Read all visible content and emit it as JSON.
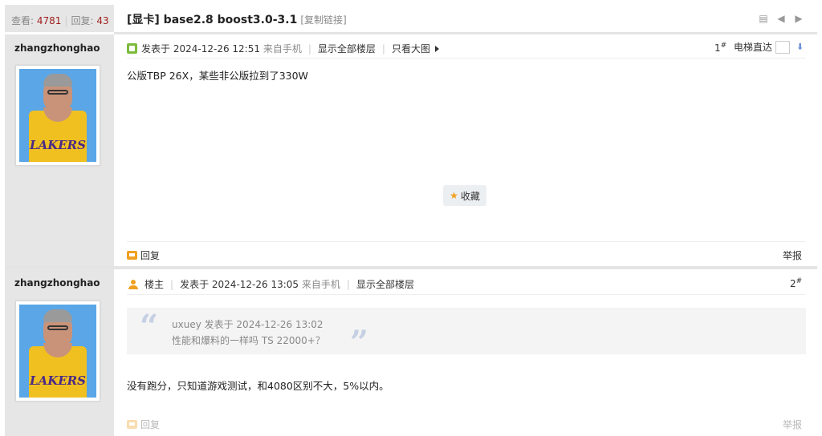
{
  "header": {
    "views_label": "查看:",
    "views": "4781",
    "replies_label": "回复:",
    "replies": "43",
    "title": "[显卡] base2.8 boost3.0-3.1",
    "copy_link": "[复制链接]"
  },
  "posts": [
    {
      "username": "zhangzhonghao",
      "avatar_text": "LAKERS",
      "posted_prefix": "发表于",
      "date": "2024-12-26 12:51",
      "source": "来自手机",
      "show_all": "显示全部楼层",
      "view_large": "只看大图",
      "floor_num": "1",
      "floor_sym": "#",
      "jump_label": "电梯直达",
      "content": "公版TBP 26X，某些非公版拉到了330W",
      "favorite": "收藏",
      "reply": "回复",
      "report": "举报"
    },
    {
      "username": "zhangzhonghao",
      "avatar_text": "LAKERS",
      "op_label": "楼主",
      "posted_prefix": "发表于",
      "date": "2024-12-26 13:05",
      "source": "来自手机",
      "show_all": "显示全部楼层",
      "floor_num": "2",
      "floor_sym": "#",
      "quote": {
        "author_line": "uxuey 发表于 2024-12-26 13:02",
        "text": "性能和爆料的一样吗 TS 22000+？"
      },
      "content": "没有跑分，只知道游戏测试，和4080区别不大，5%以内。",
      "reply": "回复",
      "report": "举报"
    }
  ],
  "icons": [
    "print-icon",
    "prev-arrow-icon",
    "next-arrow-icon",
    "star-icon",
    "reply-icon",
    "user-icon",
    "down-arrow-icon"
  ]
}
